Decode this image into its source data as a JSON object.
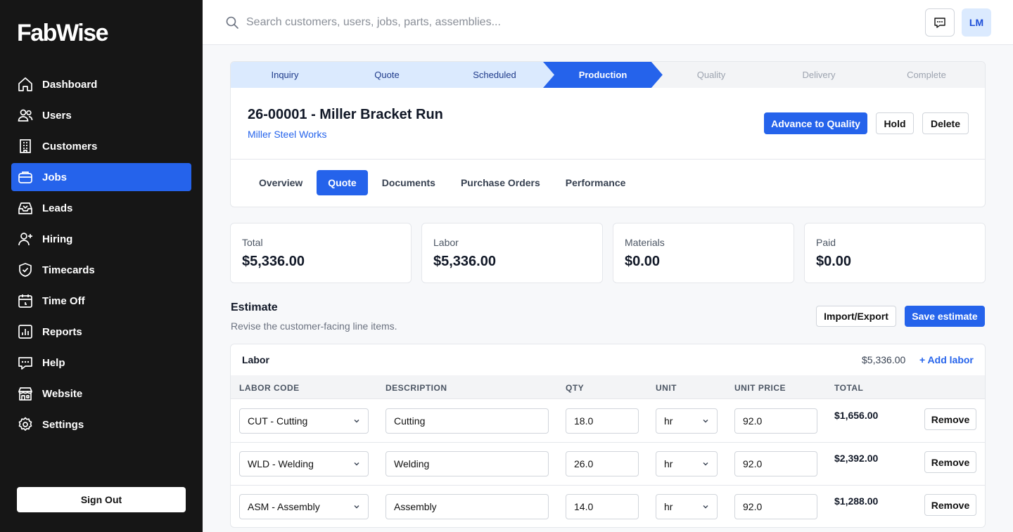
{
  "app": {
    "logo": "FabWise"
  },
  "sidebar": {
    "items": [
      {
        "label": "Dashboard",
        "icon": "home-icon",
        "active": false
      },
      {
        "label": "Users",
        "icon": "users-icon",
        "active": false
      },
      {
        "label": "Customers",
        "icon": "building-icon",
        "active": false
      },
      {
        "label": "Jobs",
        "icon": "briefcase-icon",
        "active": true
      },
      {
        "label": "Leads",
        "icon": "inbox-icon",
        "active": false
      },
      {
        "label": "Hiring",
        "icon": "user-plus-icon",
        "active": false
      },
      {
        "label": "Timecards",
        "icon": "shield-check-icon",
        "active": false
      },
      {
        "label": "Time Off",
        "icon": "calendar-icon",
        "active": false
      },
      {
        "label": "Reports",
        "icon": "bar-chart-icon",
        "active": false
      },
      {
        "label": "Help",
        "icon": "message-icon",
        "active": false
      },
      {
        "label": "Website",
        "icon": "storefront-icon",
        "active": false
      },
      {
        "label": "Settings",
        "icon": "gear-icon",
        "active": false
      }
    ],
    "sign_out_label": "Sign Out"
  },
  "topbar": {
    "search_placeholder": "Search customers, users, jobs, parts, assemblies...",
    "user_initials": "LM"
  },
  "stepper": {
    "steps": [
      {
        "label": "Inquiry",
        "status": "done"
      },
      {
        "label": "Quote",
        "status": "done"
      },
      {
        "label": "Scheduled",
        "status": "done"
      },
      {
        "label": "Production",
        "status": "current"
      },
      {
        "label": "Quality",
        "status": "todo"
      },
      {
        "label": "Delivery",
        "status": "todo"
      },
      {
        "label": "Complete",
        "status": "todo"
      }
    ]
  },
  "job": {
    "title": "26-00001 - Miller Bracket Run",
    "customer": "Miller Steel Works",
    "advance_label": "Advance to Quality",
    "hold_label": "Hold",
    "delete_label": "Delete"
  },
  "tabs": [
    {
      "label": "Overview",
      "active": false
    },
    {
      "label": "Quote",
      "active": true
    },
    {
      "label": "Documents",
      "active": false
    },
    {
      "label": "Purchase Orders",
      "active": false
    },
    {
      "label": "Performance",
      "active": false
    }
  ],
  "stats": [
    {
      "label": "Total",
      "value": "$5,336.00"
    },
    {
      "label": "Labor",
      "value": "$5,336.00"
    },
    {
      "label": "Materials",
      "value": "$0.00"
    },
    {
      "label": "Paid",
      "value": "$0.00"
    }
  ],
  "estimate": {
    "title": "Estimate",
    "subtitle": "Revise the customer-facing line items.",
    "import_label": "Import/Export",
    "save_label": "Save estimate"
  },
  "labor": {
    "title": "Labor",
    "total": "$5,336.00",
    "add_label": "+ Add labor",
    "columns": [
      "Labor code",
      "Description",
      "Qty",
      "Unit",
      "Unit price",
      "Total"
    ],
    "remove_label": "Remove",
    "rows": [
      {
        "code": "CUT - Cutting",
        "description": "Cutting",
        "qty": "18.0",
        "unit": "hr",
        "unit_price": "92.0",
        "total": "$1,656.00"
      },
      {
        "code": "WLD - Welding",
        "description": "Welding",
        "qty": "26.0",
        "unit": "hr",
        "unit_price": "92.0",
        "total": "$2,392.00"
      },
      {
        "code": "ASM - Assembly",
        "description": "Assembly",
        "qty": "14.0",
        "unit": "hr",
        "unit_price": "92.0",
        "total": "$1,288.00"
      }
    ]
  },
  "colors": {
    "accent": "#2563eb",
    "sidebar_bg": "#161616",
    "step_done_bg": "#dbeafe"
  }
}
